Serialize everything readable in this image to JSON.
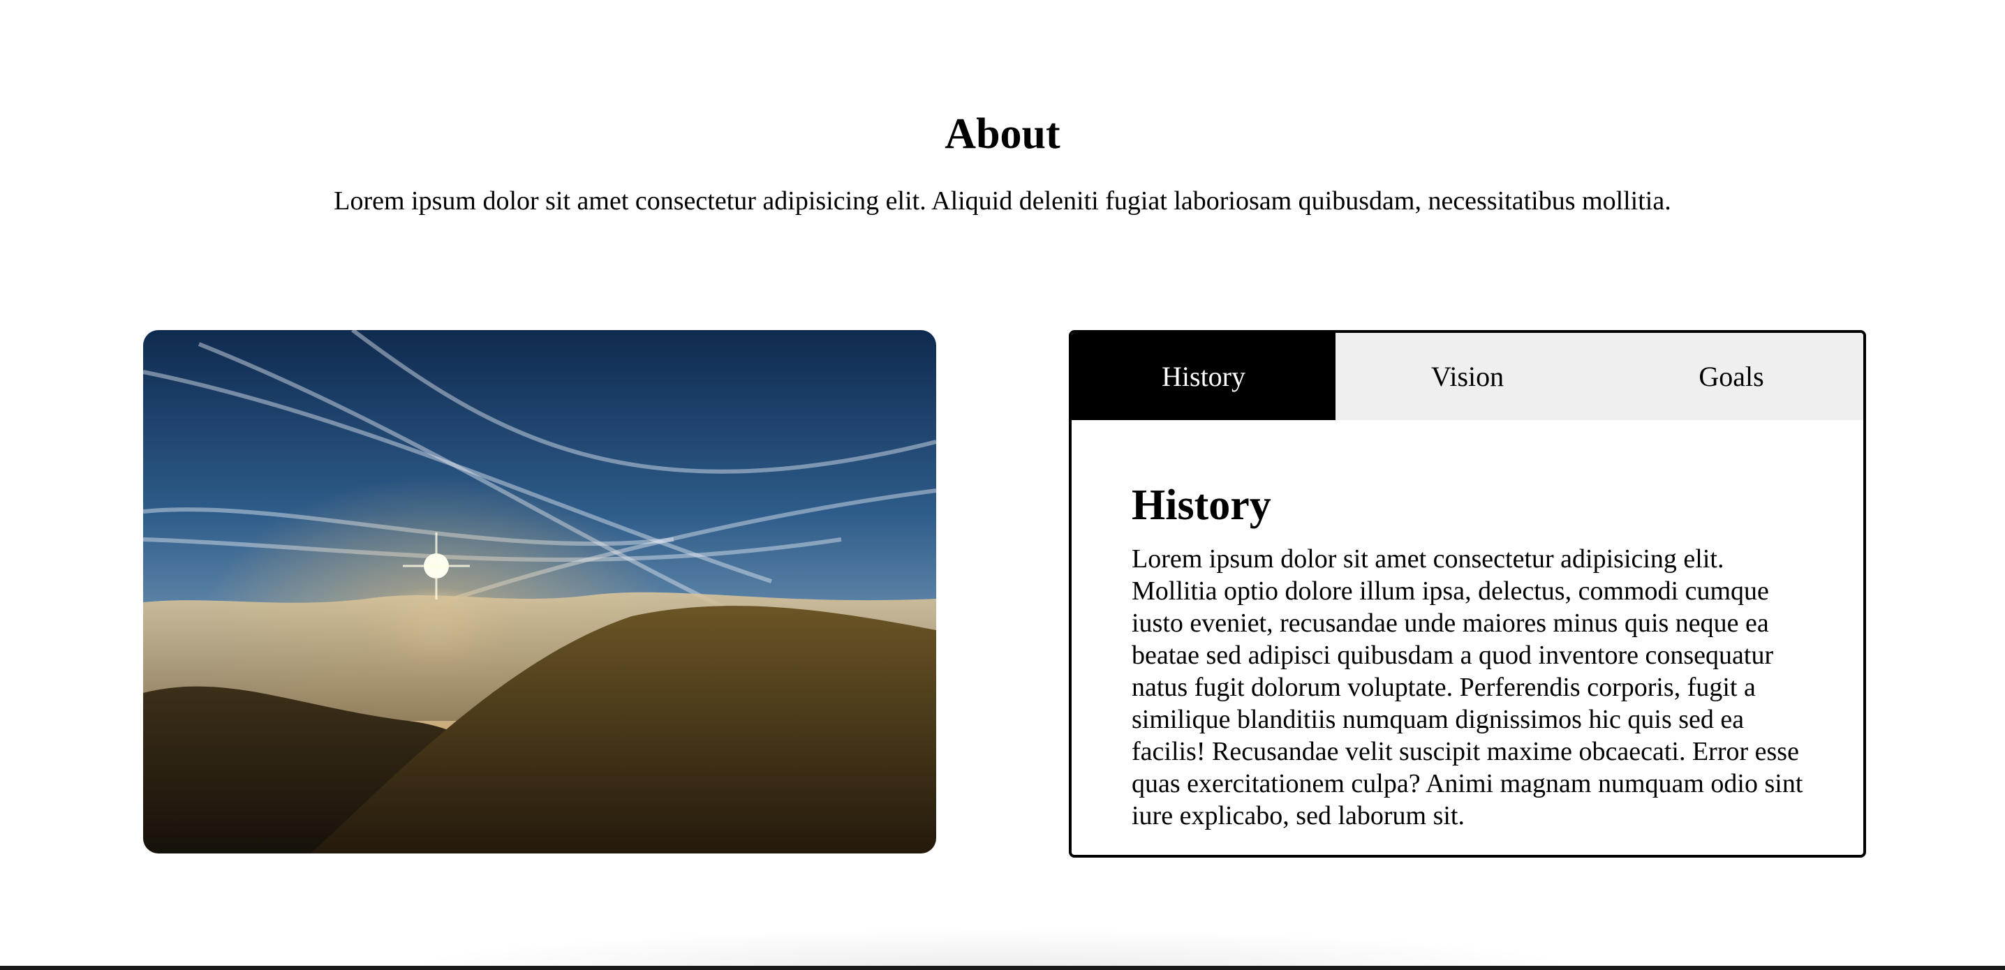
{
  "about": {
    "title": "About",
    "lead": "Lorem ipsum dolor sit amet consectetur adipisicing elit. Aliquid deleniti fugiat laboriosam quibusdam, necessitatibus mollitia."
  },
  "tabs": [
    {
      "label": "History",
      "active": true
    },
    {
      "label": "Vision",
      "active": false
    },
    {
      "label": "Goals",
      "active": false
    }
  ],
  "panel": {
    "title": "History",
    "body": "Lorem ipsum dolor sit amet consectetur adipisicing elit. Mollitia optio dolore illum ipsa, delectus, commodi cumque iusto eveniet, recusandae unde maiores minus quis neque ea beatae sed adipisci quibusdam a quod inventore consequatur natus fugit dolorum voluptate. Perferendis corporis, fugit a similique blanditiis numquam dignissimos hic quis sed ea facilis! Recusandae velit suscipit maxime obcaecati. Error esse quas exercitationem culpa? Animi magnam numquam odio sint iure explicabo, sed laborum sit."
  },
  "colors": {
    "active_tab_bg": "#000000",
    "tab_bar_bg": "#efefef",
    "text": "#000000"
  },
  "image": {
    "subject": "mountain-sunrise-above-clouds"
  }
}
